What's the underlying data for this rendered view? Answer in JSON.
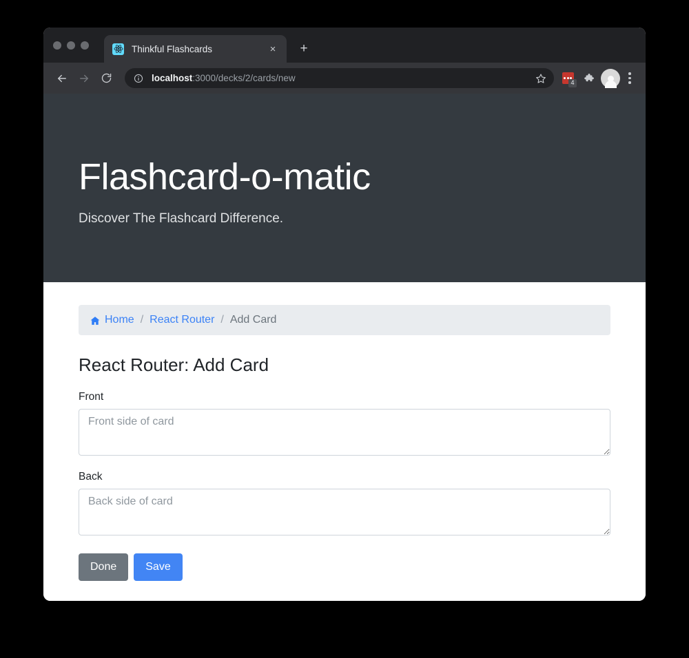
{
  "browser": {
    "tab": {
      "title": "Thinkful Flashcards",
      "favicon_name": "react-logo-favicon",
      "close_label": "×"
    },
    "new_tab_label": "+",
    "nav": {
      "back_label": "←",
      "forward_label": "→",
      "reload_label": "⟳"
    },
    "omnibox": {
      "site_info_icon": "info-circle-icon",
      "url_host": "localhost",
      "url_path": ":3000/decks/2/cards/new",
      "bookmark_icon": "star-icon"
    },
    "extensions": [
      {
        "name": "red-extension-icon",
        "badge": "4",
        "color": "#c6372e"
      },
      {
        "name": "puzzle-piece-icon",
        "badge": "",
        "color": "#c9ccd0"
      }
    ],
    "profile_icon": "avatar-icon",
    "menu_icon": "three-dot-menu-icon"
  },
  "hero": {
    "title": "Flashcard-o-matic",
    "subtitle": "Discover The Flashcard Difference.",
    "background": "#343a40"
  },
  "breadcrumb": {
    "home_icon": "home-icon",
    "home_label": "Home",
    "separator": "/",
    "deck_label": "React Router",
    "current_label": "Add Card"
  },
  "main": {
    "page_title": "React Router: Add Card",
    "fields": [
      {
        "label": "Front",
        "placeholder": "Front side of card",
        "value": ""
      },
      {
        "label": "Back",
        "placeholder": "Back side of card",
        "value": ""
      }
    ],
    "buttons": {
      "done_label": "Done",
      "save_label": "Save",
      "done_color": "#6c757d",
      "save_color": "#4285f4"
    }
  }
}
